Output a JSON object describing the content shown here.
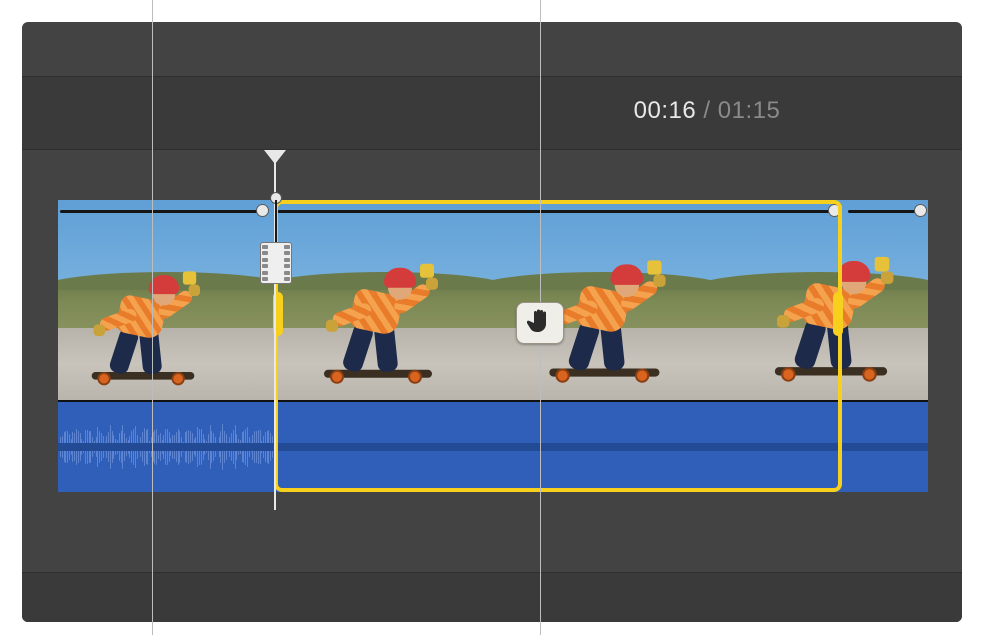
{
  "time": {
    "current": "00:16",
    "separator": " / ",
    "total": "01:15"
  },
  "icons": {
    "freeze_frame": "film-frame-icon",
    "hold": "hand-stop-icon"
  },
  "clip": {
    "audio_present": true,
    "selection": {
      "unit": "fraction_of_clip",
      "start": 0.248,
      "end": 0.902
    },
    "speed_handles": [
      0.233,
      0.89,
      0.989
    ]
  },
  "colors": {
    "selection": "#f7cf1d",
    "audio_bg": "#2f5fb8",
    "stage_bg": "#434343"
  }
}
